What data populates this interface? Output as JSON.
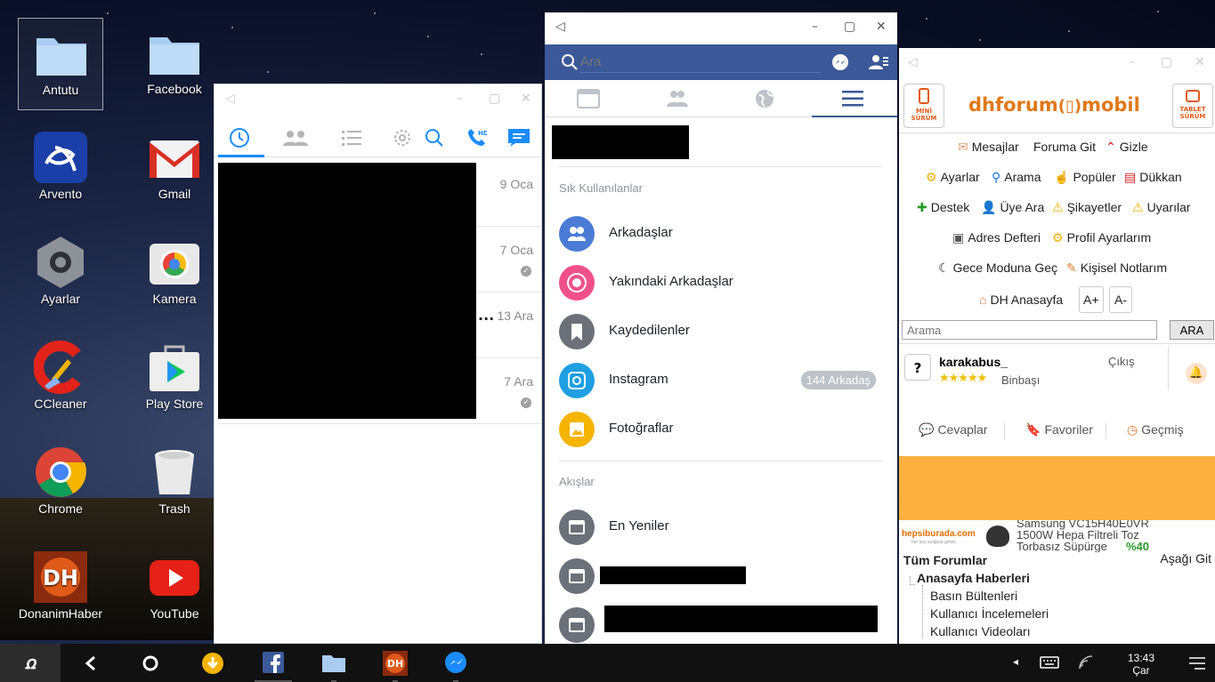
{
  "desktop": {
    "icons": [
      {
        "label": "Antutu",
        "icon": "folder-icon"
      },
      {
        "label": "Facebook",
        "icon": "folder-icon"
      },
      {
        "label": "Arvento",
        "icon": "arvento-icon"
      },
      {
        "label": "Gmail",
        "icon": "gmail-icon"
      },
      {
        "label": "Ayarlar",
        "icon": "settings-icon"
      },
      {
        "label": "Kamera",
        "icon": "camera-icon"
      },
      {
        "label": "CCleaner",
        "icon": "ccleaner-icon"
      },
      {
        "label": "Play Store",
        "icon": "play-store-icon"
      },
      {
        "label": "Chrome",
        "icon": "chrome-icon"
      },
      {
        "label": "Trash",
        "icon": "trash-icon"
      },
      {
        "label": "DonanimHaber",
        "icon": "donanimhaber-icon"
      },
      {
        "label": "YouTube",
        "icon": "youtube-icon"
      }
    ]
  },
  "messenger": {
    "rows": [
      {
        "date": "9 Oca",
        "check": false,
        "ellipsis": ""
      },
      {
        "date": "7 Oca",
        "check": true,
        "ellipsis": ""
      },
      {
        "date": "13 Ara",
        "check": false,
        "ellipsis": "..."
      },
      {
        "date": "7 Ara",
        "check": true,
        "ellipsis": ""
      }
    ]
  },
  "facebook": {
    "search_placeholder": "Ara",
    "frequent_header": "Sık Kullanılanlar",
    "items": [
      {
        "label": "Arkadaşlar",
        "color": "#4b7bd4"
      },
      {
        "label": "Yakındaki Arkadaşlar",
        "color": "#f0508a"
      },
      {
        "label": "Kaydedilenler",
        "color": "#6b7079"
      },
      {
        "label": "Instagram",
        "color": "#1f9ee2",
        "badge": "144 Arkadaş"
      },
      {
        "label": "Fotoğraflar",
        "color": "#f5b400"
      }
    ],
    "feeds_header": "Akışlar",
    "feeds": [
      {
        "label": "En Yeniler"
      }
    ]
  },
  "dhforum": {
    "mini_label": "MİNİ SÜRÜM",
    "tablet_label": "TABLET SÜRÜM",
    "logo_left": "dhforum",
    "logo_right": "mobil",
    "links": {
      "messages": "Mesajlar",
      "goto_forum": "Foruma Git",
      "hide": "Gizle",
      "settings": "Ayarlar",
      "search": "Arama",
      "popular": "Popüler",
      "shop": "Dükkan",
      "support": "Destek",
      "member_search": "Üye Ara",
      "complaints": "Şikayetler",
      "warnings": "Uyarılar",
      "address_book": "Adres Defteri",
      "profile_settings": "Profil Ayarlarım",
      "night_mode": "Gece Moduna Geç",
      "notes": "Kişisel Notlarım",
      "dh_home": "DH Anasayfa",
      "font_up": "A+",
      "font_down": "A-"
    },
    "search_placeholder": "Arama",
    "search_button": "ARA",
    "user": {
      "name": "karakabus_",
      "rank": "Binbaşı",
      "logout": "Çıkış",
      "avatar": "?"
    },
    "tabs": {
      "replies": "Cevaplar",
      "favorites": "Favoriler",
      "history": "Geçmiş"
    },
    "ad": {
      "brand": "hepsiburada.com",
      "brand_sub": "her şey ayağına gelsin",
      "product": "Samsung VC15H40E0VR 1500W Hepa Filtreli Toz Torbasız Süpürge",
      "discount": "%40"
    },
    "forum_title": "Tüm Forumlar",
    "go_down": "Aşağı Git",
    "tree": {
      "parent": "Anasayfa Haberleri",
      "children": [
        "Basın Bültenleri",
        "Kullanıcı İncelemeleri",
        "Kullanıcı Videoları"
      ]
    }
  },
  "taskbar": {
    "time": "13:43",
    "day": "Çar"
  }
}
